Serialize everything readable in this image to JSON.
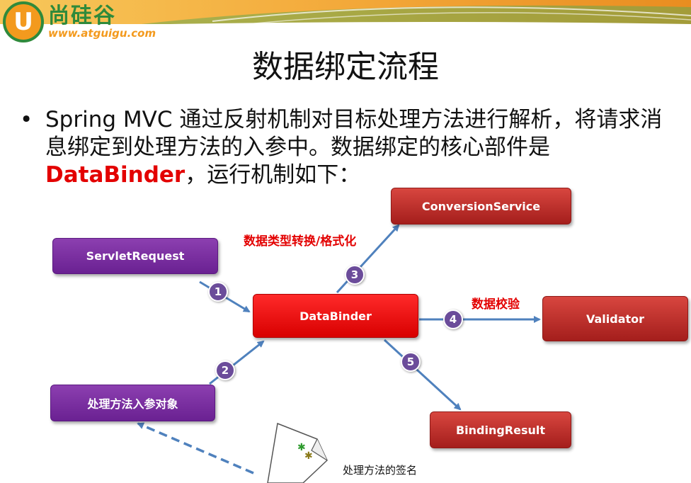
{
  "logo": {
    "mark": "U",
    "name": "尚硅谷",
    "url": "www.atguigu.com"
  },
  "title": "数据绑定流程",
  "bullet": {
    "dot": "•",
    "text_before": "Spring MVC 通过反射机制对目标处理方法进行解析，将请求消息绑定到处理方法的入参中。数据绑定的核心部件是 ",
    "highlight": "DataBinder",
    "text_after": "，运行机制如下："
  },
  "nodes": {
    "servlet_request": "ServletRequest",
    "param_object": "处理方法入参对象",
    "data_binder": "DataBinder",
    "conversion_service": "ConversionService",
    "validator": "Validator",
    "binding_result": "BindingResult"
  },
  "edge_labels": {
    "conversion": "数据类型转换/格式化",
    "validation": "数据校验"
  },
  "steps": [
    "1",
    "2",
    "3",
    "4",
    "5"
  ],
  "caption": "处理方法的签名",
  "colors": {
    "arrow": "#4f81bd",
    "highlight": "#e30000",
    "purple": "#7030a0",
    "dark_red": "#c0302a"
  }
}
